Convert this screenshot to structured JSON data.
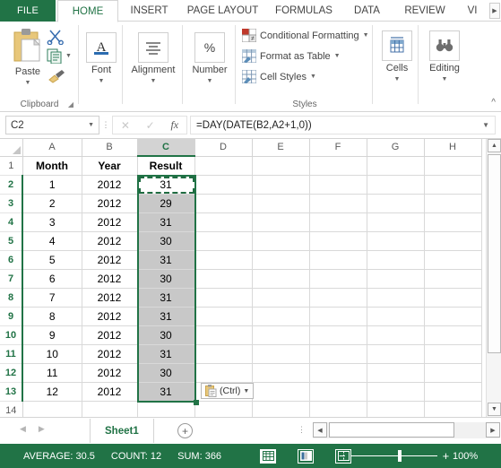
{
  "ribbon": {
    "tabs": [
      {
        "label": "FILE",
        "active": false,
        "file": true
      },
      {
        "label": "HOME",
        "active": true,
        "file": false
      },
      {
        "label": "INSERT",
        "active": false,
        "file": false
      },
      {
        "label": "PAGE LAYOUT",
        "active": false,
        "file": false
      },
      {
        "label": "FORMULAS",
        "active": false,
        "file": false
      },
      {
        "label": "DATA",
        "active": false,
        "file": false
      },
      {
        "label": "REVIEW",
        "active": false,
        "file": false
      },
      {
        "label": "VI",
        "active": false,
        "file": false
      }
    ],
    "scroll_right_icon": "chevron-right-icon",
    "groups": {
      "clipboard": {
        "label": "Clipboard",
        "paste_label": "Paste",
        "paste_icon": "clipboard-icon",
        "cut_icon": "scissors-icon",
        "copy_icon": "copy-icon",
        "format_painter_icon": "paintbrush-icon",
        "dialog_launcher_icon": "dialog-launcher-icon"
      },
      "font": {
        "label": "Font",
        "icon": "font-A-icon"
      },
      "alignment": {
        "label": "Alignment",
        "icon": "align-lines-icon"
      },
      "number": {
        "label": "Number",
        "icon": "percent-icon"
      },
      "styles": {
        "label": "Styles",
        "items": [
          {
            "label": "Conditional Formatting",
            "icon": "conditional-formatting-icon"
          },
          {
            "label": "Format as Table",
            "icon": "format-as-table-icon"
          },
          {
            "label": "Cell Styles",
            "icon": "cell-styles-icon"
          }
        ]
      },
      "cells": {
        "label": "Cells",
        "icon": "cells-insert-icon"
      },
      "editing": {
        "label": "Editing",
        "icon": "binoculars-icon"
      }
    },
    "collapse_icon": "chevron-up-icon"
  },
  "formula_bar": {
    "name_box_value": "C2",
    "name_box_arrow_icon": "chevron-down-icon",
    "cancel_icon": "cancel-x-icon",
    "enter_icon": "check-icon",
    "insert_function_icon": "fx-icon",
    "formula": "=DAY(DATE(B2,A2+1,0))",
    "expand_icon": "chevron-down-icon"
  },
  "sheet": {
    "column_headers": [
      "A",
      "B",
      "C",
      "D",
      "E",
      "F",
      "G",
      "H"
    ],
    "selected_column": "C",
    "row_headers": [
      "1",
      "2",
      "3",
      "4",
      "5",
      "6",
      "7",
      "8",
      "9",
      "10",
      "11",
      "12",
      "13",
      "14"
    ],
    "header_row": [
      "Month",
      "Year",
      "Result"
    ],
    "rows": [
      {
        "row": "2",
        "month": "1",
        "year": "2012",
        "result": "31"
      },
      {
        "row": "3",
        "month": "2",
        "year": "2012",
        "result": "29"
      },
      {
        "row": "4",
        "month": "3",
        "year": "2012",
        "result": "31"
      },
      {
        "row": "5",
        "month": "4",
        "year": "2012",
        "result": "30"
      },
      {
        "row": "6",
        "month": "5",
        "year": "2012",
        "result": "31"
      },
      {
        "row": "7",
        "month": "6",
        "year": "2012",
        "result": "30"
      },
      {
        "row": "8",
        "month": "7",
        "year": "2012",
        "result": "31"
      },
      {
        "row": "9",
        "month": "8",
        "year": "2012",
        "result": "31"
      },
      {
        "row": "10",
        "month": "9",
        "year": "2012",
        "result": "30"
      },
      {
        "row": "11",
        "month": "10",
        "year": "2012",
        "result": "31"
      },
      {
        "row": "12",
        "month": "11",
        "year": "2012",
        "result": "30"
      },
      {
        "row": "13",
        "month": "12",
        "year": "2012",
        "result": "31"
      }
    ],
    "selection_range": "C2:C13",
    "copy_marquee_cell": "C2",
    "paste_options": {
      "label": "(Ctrl)",
      "icon": "paste-options-clipboard-icon",
      "arrow_icon": "chevron-down-icon"
    }
  },
  "sheet_bar": {
    "prev_icon": "triangle-left-icon",
    "next_icon": "triangle-right-icon",
    "tabs": [
      {
        "label": "Sheet1",
        "active": true
      }
    ],
    "add_sheet_icon": "plus-circle-icon",
    "more_icon": "ellipsis-vertical-icon",
    "hscroll_left_icon": "triangle-left-icon",
    "hscroll_right_icon": "triangle-right-icon"
  },
  "scrollbar": {
    "up_icon": "triangle-up-icon",
    "down_icon": "triangle-down-icon"
  },
  "status_bar": {
    "average": "AVERAGE: 30.5",
    "count": "COUNT: 12",
    "sum": "SUM: 366",
    "view_normal_icon": "normal-view-icon",
    "view_layout_icon": "page-layout-view-icon",
    "view_break_icon": "page-break-view-icon",
    "zoom_out": "−",
    "zoom_in": "+",
    "zoom_level": "100%"
  },
  "colors": {
    "excel_green": "#217346",
    "selection_gray": "#c8c8c8",
    "grid_line": "#d9d9d9"
  }
}
